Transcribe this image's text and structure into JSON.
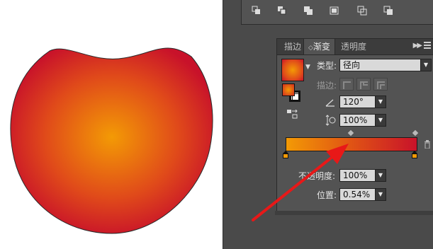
{
  "canvas": {
    "shape": "radial-gradient-blob"
  },
  "toolbar": {
    "icons": [
      "arrange-icon-1",
      "arrange-icon-2",
      "arrange-icon-3",
      "arrange-icon-4",
      "arrange-icon-5",
      "arrange-icon-6"
    ]
  },
  "panel": {
    "tabs": [
      {
        "label": "描边",
        "active": false
      },
      {
        "label": "渐变",
        "active": true
      },
      {
        "label": "透明度",
        "active": false
      }
    ],
    "type_label": "类型:",
    "type_value": "径向",
    "stroke_label": "描边:",
    "angle_value": "120°",
    "aspect_value": "100%",
    "opacity_label": "不透明度:",
    "opacity_value": "100%",
    "location_label": "位置:",
    "location_value": "0.54%"
  },
  "gradient": {
    "start_color": "#f39a05",
    "end_color": "#c8122a",
    "stops": [
      "#f39a05",
      "#c8122a"
    ]
  },
  "colors": {
    "panel_bg": "#535353",
    "app_bg": "#4a4a4a",
    "arrow": "#e81818"
  }
}
